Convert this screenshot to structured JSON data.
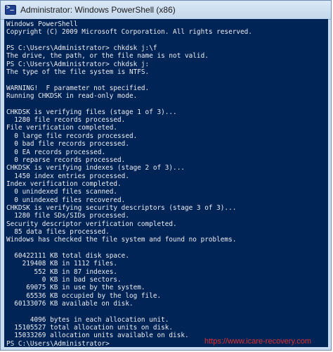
{
  "window": {
    "title": "Administrator: Windows PowerShell (x86)",
    "icon": "powershell-icon"
  },
  "console": {
    "background": "#012456",
    "foreground": "#eeedf0",
    "lines": [
      "Windows PowerShell",
      "Copyright (C) 2009 Microsoft Corporation. All rights reserved.",
      "",
      "PS C:\\Users\\Administrator> chkdsk j:\\f",
      "The drive, the path, or the file name is not valid.",
      "PS C:\\Users\\Administrator> chkdsk j:",
      "The type of the file system is NTFS.",
      "",
      "WARNING!  F parameter not specified.",
      "Running CHKDSK in read-only mode.",
      "",
      "CHKDSK is verifying files (stage 1 of 3)...",
      "  1280 file records processed.",
      "File verification completed.",
      "  0 large file records processed.",
      "  0 bad file records processed.",
      "  0 EA records processed.",
      "  0 reparse records processed.",
      "CHKDSK is verifying indexes (stage 2 of 3)...",
      "  1450 index entries processed.",
      "Index verification completed.",
      "  0 unindexed files scanned.",
      "  0 unindexed files recovered.",
      "CHKDSK is verifying security descriptors (stage 3 of 3)...",
      "  1280 file SDs/SIDs processed.",
      "Security descriptor verification completed.",
      "  85 data files processed.",
      "Windows has checked the file system and found no problems.",
      "",
      "  60422111 KB total disk space.",
      "    219408 KB in 1112 files.",
      "       552 KB in 87 indexes.",
      "         0 KB in bad sectors.",
      "     69075 KB in use by the system.",
      "     65536 KB occupied by the log file.",
      "  60133076 KB available on disk.",
      "",
      "      4096 bytes in each allocation unit.",
      "  15105527 total allocation units on disk.",
      "  15033269 allocation units available on disk.",
      "PS C:\\Users\\Administrator>"
    ]
  },
  "watermark": {
    "text": "https://www.icare-recovery.com",
    "color": "#e03030"
  }
}
